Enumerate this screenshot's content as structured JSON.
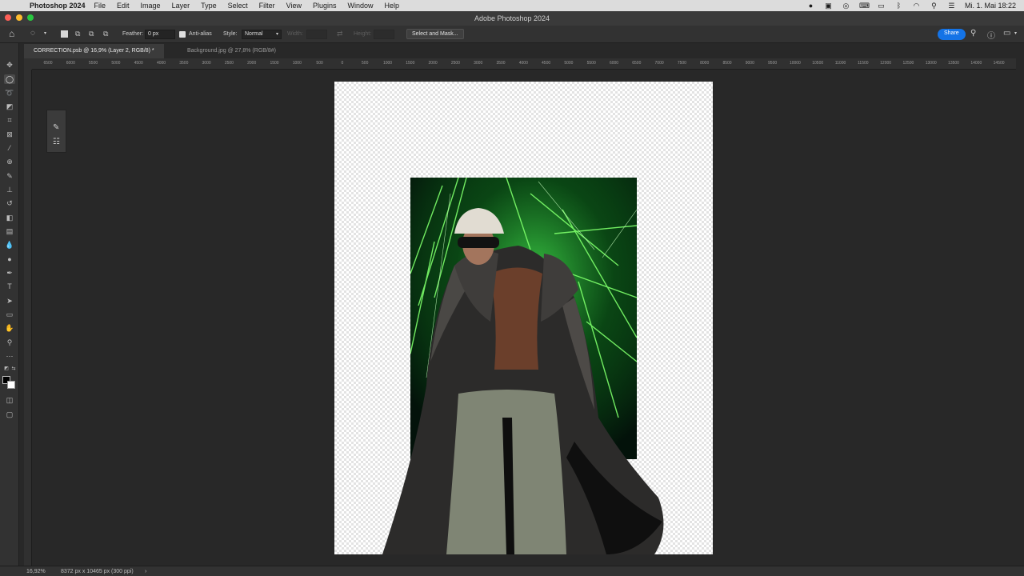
{
  "menubar": {
    "apple": "",
    "app_name": "Photoshop 2024",
    "items": [
      "File",
      "Edit",
      "Image",
      "Layer",
      "Type",
      "Select",
      "Filter",
      "View",
      "Plugins",
      "Window",
      "Help"
    ],
    "datetime": "Mi. 1. Mai 18:22",
    "status_icons": [
      "record-icon",
      "display-icon",
      "airdrop-icon",
      "keyboard-icon",
      "battery-icon",
      "bluetooth-icon",
      "wifi-icon",
      "spotlight-icon",
      "control-center-icon"
    ]
  },
  "window": {
    "title": "Adobe Photoshop 2024"
  },
  "traffic_colors": {
    "close": "#fe5f57",
    "minimize": "#febc2e",
    "zoom": "#28c840"
  },
  "options_bar": {
    "feather_label": "Feather:",
    "feather_value": "0 px",
    "anti_alias_label": "Anti-alias",
    "style_label": "Style:",
    "style_value": "Normal",
    "width_label": "Width:",
    "height_label": "Height:",
    "select_and_mask": "Select and Mask...",
    "share_label": "Share",
    "accent": "#1473e6"
  },
  "tabs": [
    {
      "label": "CORRECTION.psb @ 16,9% (Layer 2, RGB/8) *",
      "active": true
    },
    {
      "label": "Background.jpg @ 27,8% (RGB/8#)",
      "active": false
    }
  ],
  "ruler_labels": [
    "6500",
    "6000",
    "5500",
    "5000",
    "4500",
    "4000",
    "3500",
    "3000",
    "2500",
    "2000",
    "1500",
    "1000",
    "500",
    "0",
    "500",
    "1000",
    "1500",
    "2000",
    "2500",
    "3000",
    "3500",
    "4000",
    "4500",
    "5000",
    "5500",
    "6000",
    "6500",
    "7000",
    "7500",
    "8000",
    "8500",
    "9000",
    "9500",
    "10000",
    "10500",
    "11000",
    "11500",
    "12000",
    "12500",
    "13000",
    "13500",
    "14000",
    "14500"
  ],
  "status": {
    "zoom": "16,92%",
    "doc_info": "8372 px x 10465 px (300 ppi)"
  }
}
